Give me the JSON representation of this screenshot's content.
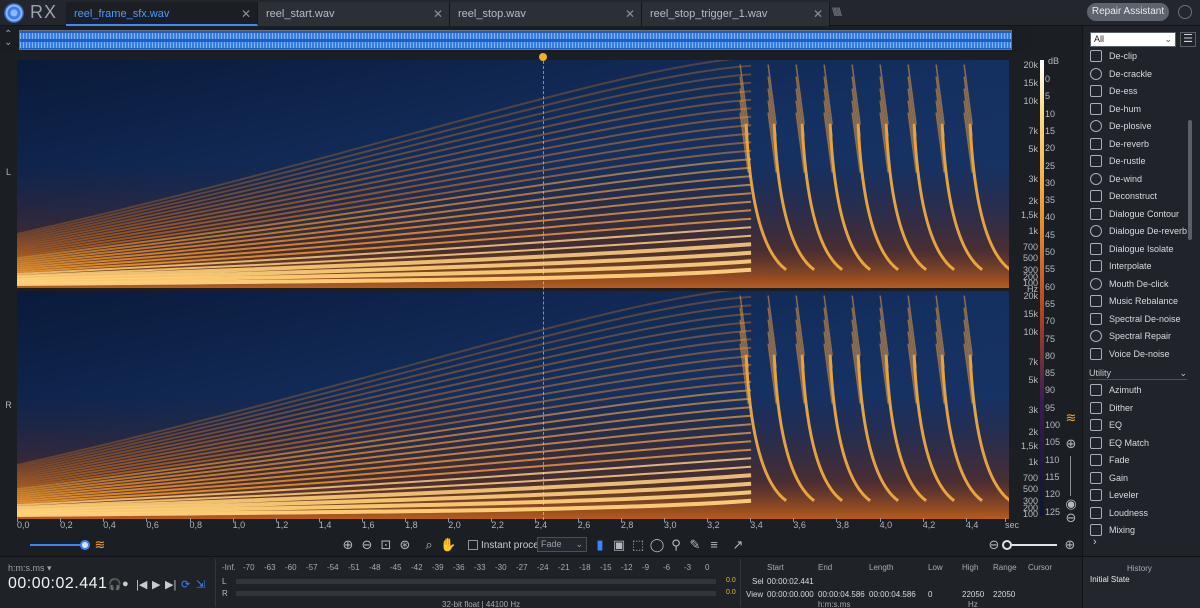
{
  "app": {
    "logo_text": "RX"
  },
  "tabs": [
    {
      "label": "reel_frame_sfx.wav",
      "active": true
    },
    {
      "label": "reel_start.wav",
      "active": false
    },
    {
      "label": "reel_stop.wav",
      "active": false
    },
    {
      "label": "reel_stop_trigger_1.wav",
      "active": false
    }
  ],
  "header": {
    "repair_assistant": "Repair Assistant"
  },
  "channels": {
    "left": "L",
    "right": "R"
  },
  "hz_scale": {
    "unit": "Hz",
    "ticks": [
      "20k",
      "15k",
      "10k",
      "7k",
      "5k",
      "3k",
      "2k",
      "1,5k",
      "1k",
      "700",
      "500",
      "300",
      "200",
      "100"
    ]
  },
  "db_scale": {
    "unit": "dB",
    "ticks": [
      "0",
      "5",
      "10",
      "15",
      "20",
      "25",
      "30",
      "35",
      "40",
      "45",
      "50",
      "55",
      "60",
      "65",
      "70",
      "75",
      "80",
      "85",
      "90",
      "95",
      "100",
      "105",
      "110",
      "115",
      "120",
      "125"
    ]
  },
  "time_axis": {
    "unit": "sec",
    "ticks": [
      "0,0",
      "0,2",
      "0,4",
      "0,6",
      "0,8",
      "1,0",
      "1,2",
      "1,4",
      "1,6",
      "1,8",
      "2,0",
      "2,2",
      "2,4",
      "2,6",
      "2,8",
      "3,0",
      "3,2",
      "3,4",
      "3,6",
      "3,8",
      "4,0",
      "4,2",
      "4,4"
    ]
  },
  "playhead_seconds": 2.441,
  "duration_seconds": 4.586,
  "toolbar": {
    "instant_process": "Instant process",
    "fade": "Fade"
  },
  "sidebar": {
    "filter": "All",
    "repair_modules": [
      "De-clip",
      "De-crackle",
      "De-ess",
      "De-hum",
      "De-plosive",
      "De-reverb",
      "De-rustle",
      "De-wind",
      "Deconstruct",
      "Dialogue Contour",
      "Dialogue De-reverb",
      "Dialogue Isolate",
      "Interpolate",
      "Mouth De-click",
      "Music Rebalance",
      "Spectral De-noise",
      "Spectral Repair",
      "Voice De-noise"
    ],
    "utility_label": "Utility",
    "utility_modules": [
      "Azimuth",
      "Dither",
      "EQ",
      "EQ Match",
      "Fade",
      "Gain",
      "Leveler",
      "Loudness",
      "Mixing"
    ]
  },
  "status": {
    "time_format": "h:m:s.ms",
    "current_time": "00:00:02.441",
    "meter_scale": [
      "-Inf.",
      "-70",
      "-63",
      "-60",
      "-57",
      "-54",
      "-51",
      "-48",
      "-45",
      "-42",
      "-39",
      "-36",
      "-33",
      "-30",
      "-27",
      "-24",
      "-21",
      "-18",
      "-15",
      "-12",
      "-9",
      "-6",
      "-3",
      "0"
    ],
    "meter_left_label": "L",
    "meter_right_label": "R",
    "meter_left_peak": "0.0",
    "meter_right_peak": "0.0",
    "format_info": "32-bit float | 44100 Hz",
    "headers": {
      "start": "Start",
      "end": "End",
      "length": "Length",
      "low": "Low",
      "high": "High",
      "range": "Range",
      "cursor": "Cursor"
    },
    "sel_label": "Sel",
    "view_label": "View",
    "sel_start": "00:00:02.441",
    "view_start": "00:00:00.000",
    "view_end": "00:00:04.586",
    "view_length": "00:00:04.586",
    "view_low": "0",
    "view_high": "22050",
    "view_range": "22050",
    "time_unit": "h:m:s.ms",
    "hz_unit": "Hz",
    "history_title": "History",
    "history_item": "Initial State"
  }
}
